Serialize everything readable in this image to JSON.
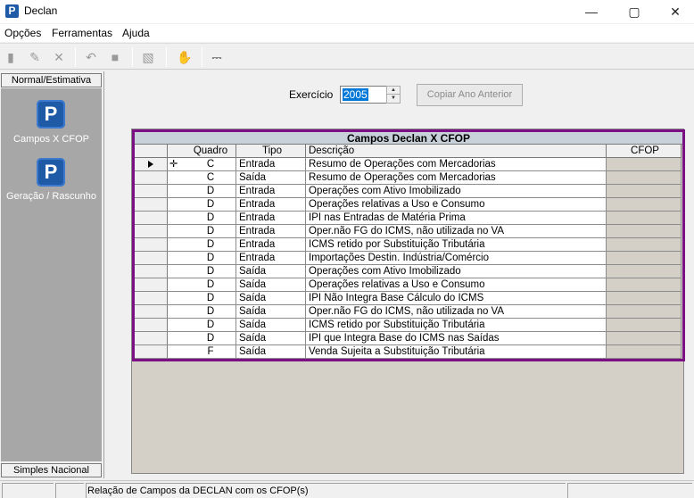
{
  "window": {
    "title": "Declan",
    "app_icon": "P"
  },
  "menu": {
    "items": [
      "Opções",
      "Ferramentas",
      "Ajuda"
    ]
  },
  "left_panel": {
    "header": "Normal/Estimativa",
    "items": [
      {
        "label": "Campos X CFOP",
        "icon": "P"
      },
      {
        "label": "Geração / Rascunho",
        "icon": "P"
      }
    ],
    "footer": "Simples Nacional"
  },
  "exercicio": {
    "label": "Exercício",
    "value": "2005"
  },
  "copy_button": {
    "label": "Copiar Ano Anterior"
  },
  "grid": {
    "title": "Campos Declan X CFOP",
    "columns": [
      "Quadro",
      "Tipo",
      "Descrição",
      "CFOP"
    ],
    "rows": [
      {
        "quadro": "C",
        "tipo": "Entrada",
        "descricao": "Resumo de Operações com Mercadorias",
        "cfop": ""
      },
      {
        "quadro": "C",
        "tipo": "Saída",
        "descricao": "Resumo de Operações com Mercadorias",
        "cfop": ""
      },
      {
        "quadro": "D",
        "tipo": "Entrada",
        "descricao": "Operações com Ativo Imobilizado",
        "cfop": ""
      },
      {
        "quadro": "D",
        "tipo": "Entrada",
        "descricao": "Operações relativas a Uso e Consumo",
        "cfop": ""
      },
      {
        "quadro": "D",
        "tipo": "Entrada",
        "descricao": "IPI nas Entradas de Matéria Prima",
        "cfop": ""
      },
      {
        "quadro": "D",
        "tipo": "Entrada",
        "descricao": "Oper.não FG do ICMS, não utilizada no VA",
        "cfop": ""
      },
      {
        "quadro": "D",
        "tipo": "Entrada",
        "descricao": "ICMS retido por Substituição Tributária",
        "cfop": ""
      },
      {
        "quadro": "D",
        "tipo": "Entrada",
        "descricao": "Importações Destin. Indústria/Comércio",
        "cfop": ""
      },
      {
        "quadro": "D",
        "tipo": "Saída",
        "descricao": "Operações com Ativo Imobilizado",
        "cfop": ""
      },
      {
        "quadro": "D",
        "tipo": "Saída",
        "descricao": "Operações relativas a Uso e Consumo",
        "cfop": ""
      },
      {
        "quadro": "D",
        "tipo": "Saída",
        "descricao": "IPI Não Integra Base Cálculo do ICMS",
        "cfop": ""
      },
      {
        "quadro": "D",
        "tipo": "Saída",
        "descricao": "Oper.não FG do ICMS, não utilizada no VA",
        "cfop": ""
      },
      {
        "quadro": "D",
        "tipo": "Saída",
        "descricao": "ICMS retido por Substituição Tributária",
        "cfop": ""
      },
      {
        "quadro": "D",
        "tipo": "Saída",
        "descricao": "IPI que Integra Base do ICMS nas Saídas",
        "cfop": ""
      },
      {
        "quadro": "F",
        "tipo": "Saída",
        "descricao": "Venda Sujeita a Substituição Tributária",
        "cfop": ""
      }
    ]
  },
  "status": {
    "text": "Relação de Campos da DECLAN com os CFOP(s)"
  },
  "colors": {
    "grid_border": "#7b0f84",
    "brand": "#1f5aa6",
    "selection": "#0078d7"
  }
}
